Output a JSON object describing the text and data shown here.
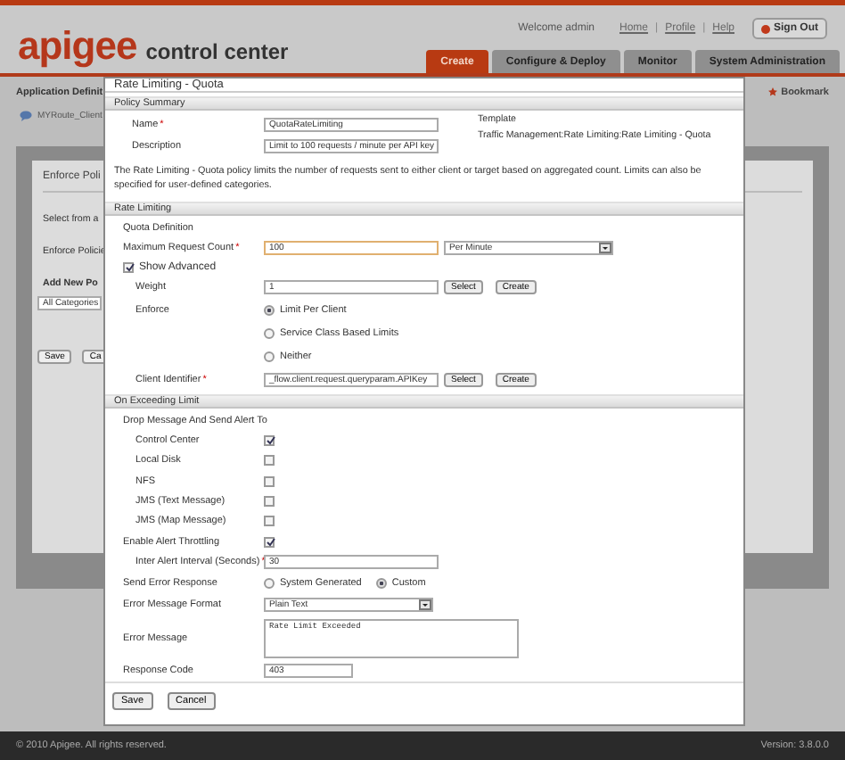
{
  "header": {
    "brand": "apigee",
    "product": "control center",
    "welcome": "Welcome admin",
    "links": [
      "Home",
      "Profile",
      "Help"
    ],
    "link_separator": "|",
    "sign_out": "Sign Out",
    "tabs": [
      {
        "label": "Create",
        "selected": true
      },
      {
        "label": "Configure & Deploy",
        "selected": false
      },
      {
        "label": "Monitor",
        "selected": false
      },
      {
        "label": "System Administration",
        "selected": false
      }
    ]
  },
  "background": {
    "breadcrumb": "Application Definit",
    "bookmark": "Bookmark",
    "route": "MYRoute_Client",
    "panel_title": "Enforce Poli",
    "lines": [
      "Select from a",
      "Enforce Policie",
      "Add New Po"
    ],
    "category": "All Categories",
    "buttons": [
      "Save",
      "Ca"
    ]
  },
  "dialog": {
    "title": "Rate Limiting - Quota",
    "required_mark": "*",
    "summary": {
      "heading": "Policy Summary",
      "fields": [
        {
          "label": "Name",
          "required": true,
          "value": "QuotaRateLimiting"
        },
        {
          "label": "Description",
          "required": false,
          "value": "Limit to 100 requests / minute per API key"
        }
      ],
      "template_label": "Template",
      "template_value": "Traffic Management:Rate Limiting:Rate Limiting - Quota"
    },
    "description": "The Rate Limiting - Quota policy limits the number of requests sent to either client or target based on aggregated count. Limits can also be specified for user-defined categories.",
    "rate_limiting": {
      "heading": "Rate Limiting",
      "subheading": "Quota Definition",
      "max_count": {
        "label": "Maximum Request Count",
        "required": true,
        "value": "100",
        "unit": "Per Minute"
      },
      "show_advanced": {
        "label": "Show Advanced",
        "checked": true
      },
      "weight": {
        "label": "Weight",
        "value": "1",
        "buttons": [
          "Select",
          "Create"
        ]
      },
      "enforce": {
        "label": "Enforce",
        "options": [
          {
            "label": "Limit Per Client",
            "selected": true
          },
          {
            "label": "Service Class Based Limits",
            "selected": false
          },
          {
            "label": "Neither",
            "selected": false
          }
        ]
      },
      "client_identifier": {
        "label": "Client Identifier",
        "required": true,
        "value": "_flow.client.request.queryparam.APIKey",
        "buttons": [
          "Select",
          "Create"
        ]
      }
    },
    "exceeding": {
      "heading": "On Exceeding Limit",
      "alert_heading": "Drop Message And Send Alert To",
      "targets": [
        {
          "label": "Control Center",
          "checked": true
        },
        {
          "label": "Local Disk",
          "checked": false
        },
        {
          "label": "NFS",
          "checked": false
        },
        {
          "label": "JMS (Text Message)",
          "checked": false
        },
        {
          "label": "JMS (Map Message)",
          "checked": false
        }
      ],
      "throttling": {
        "label": "Enable Alert Throttling",
        "checked": true
      },
      "interval": {
        "label": "Inter Alert Interval (Seconds)",
        "required": true,
        "value": "30"
      },
      "send_error": {
        "label": "Send Error Response",
        "options": [
          {
            "label": "System Generated",
            "selected": false
          },
          {
            "label": "Custom",
            "selected": true
          }
        ]
      },
      "format": {
        "label": "Error Message Format",
        "value": "Plain Text"
      },
      "message": {
        "label": "Error Message",
        "value": "Rate Limit Exceeded"
      },
      "response_code": {
        "label": "Response Code",
        "value": "403"
      }
    },
    "buttons": [
      "Save",
      "Cancel"
    ]
  },
  "footer": {
    "copyright": "© 2010 Apigee. All rights reserved.",
    "version": "Version: 3.8.0.0"
  }
}
